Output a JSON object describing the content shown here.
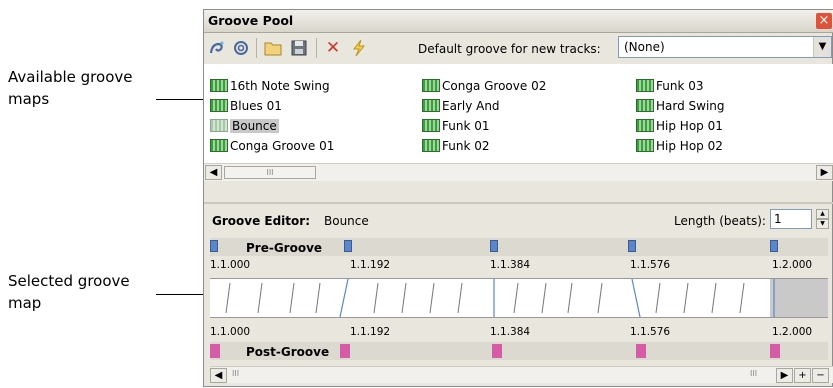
{
  "callouts": {
    "available": [
      "Available groove",
      "maps"
    ],
    "selected": [
      "Selected groove",
      "map"
    ]
  },
  "window": {
    "title": "Groove Pool",
    "close_glyph": "×"
  },
  "toolbar": {
    "icons": [
      "groove-new-icon",
      "groove-clone-icon",
      "folder-open-icon",
      "save-icon",
      "delete-icon",
      "apply-groove-icon"
    ],
    "default_label": "Default groove for new tracks:",
    "default_value": "(None)"
  },
  "grooves": {
    "col1": [
      "16th Note Swing",
      "Blues 01",
      "Bounce",
      "Conga Groove 01"
    ],
    "col2": [
      "Conga Groove 02",
      "Early And",
      "Funk 01",
      "Funk 02"
    ],
    "col3": [
      "Funk 03",
      "Hard Swing",
      "Hip Hop 01",
      "Hip Hop 02"
    ],
    "selected": "Bounce"
  },
  "scroll": {
    "thumb_grip": "III"
  },
  "editor": {
    "label": "Groove Editor:",
    "name": "Bounce",
    "length_label": "Length (beats):",
    "length_value": "1",
    "pre_label": "Pre-Groove",
    "post_label": "Post-Groove",
    "ticks": [
      "1.1.000",
      "1.1.192",
      "1.1.384",
      "1.1.576",
      "1.2.000"
    ]
  },
  "colors": {
    "marker_blue": "#5b87c8",
    "marker_pink": "#d75ca8",
    "groove_icon_green": "#3f9c3f",
    "selection_gray": "#c8c8c8"
  }
}
